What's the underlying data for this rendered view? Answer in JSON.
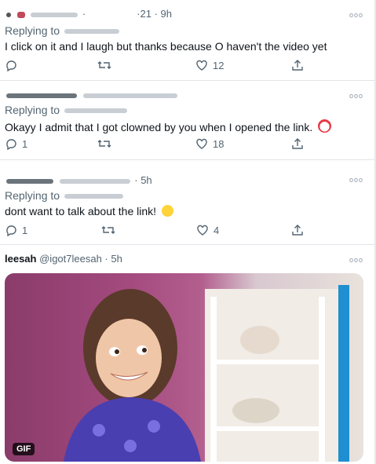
{
  "tweets": [
    {
      "header": "·                  ·21 · 9h",
      "replying_label": "Replying to",
      "text": "I click on it and I laugh but thanks because O haven't the video yet",
      "reply_count": "",
      "retweet_count": "",
      "like_count": "12"
    },
    {
      "header": "",
      "replying_label": "Replying to",
      "text": "Okayy I admit that I got clowned by you when I opened the link.",
      "reply_count": "1",
      "retweet_count": "",
      "like_count": "18"
    },
    {
      "header": "· 5h",
      "replying_label": "Replying to",
      "text": "dont want to talk about the link!",
      "reply_count": "1",
      "retweet_count": "",
      "like_count": "4"
    },
    {
      "display_name": "leesah",
      "handle": "@igot7leesah · 5h",
      "gif_label": "GIF"
    }
  ],
  "colors": {
    "text": "#0f1419",
    "secondary": "#536471",
    "divider": "#e1e6ea"
  },
  "icons": [
    "reply-icon",
    "retweet-icon",
    "like-icon",
    "share-icon",
    "more-icon",
    "clown-emoji",
    "laughing-emoji"
  ]
}
